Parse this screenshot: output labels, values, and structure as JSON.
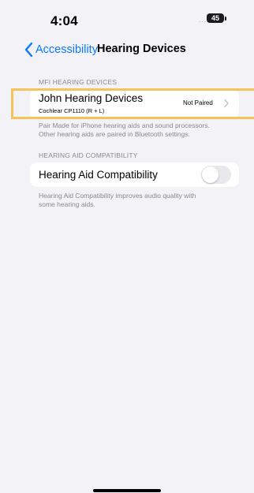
{
  "status_bar": {
    "time": "4:04",
    "signal": "....",
    "battery": "45"
  },
  "nav": {
    "back_label": "Accessibility",
    "title": "Hearing Devices"
  },
  "mfi_section": {
    "header": "MFI HEARING DEVICES",
    "device": {
      "name": "John Hearing Devices",
      "model": "Cochlear CP1110 (R + L)",
      "status": "Not Paired"
    },
    "footer_line1": "Pair Made for iPhone hearing aids and sound processors.",
    "footer_line2": "Other hearing aids are paired in Bluetooth settings."
  },
  "compat_section": {
    "header": "HEARING AID COMPATIBILITY",
    "label": "Hearing Aid Compatibility",
    "toggle_on": false,
    "footer_line1": "Hearing Aid Compatibility improves audio quality with",
    "footer_line2": "some hearing aids."
  },
  "colors": {
    "background": "#f2f2f7",
    "accent_blue": "#0a7aff",
    "highlight": "#f6c25a",
    "secondary_text": "#8a8a8e",
    "toggle_off": "#e9e9eb"
  },
  "icons": {
    "back": "chevron-left-icon",
    "disclosure": "chevron-right-icon",
    "battery": "battery-icon"
  }
}
